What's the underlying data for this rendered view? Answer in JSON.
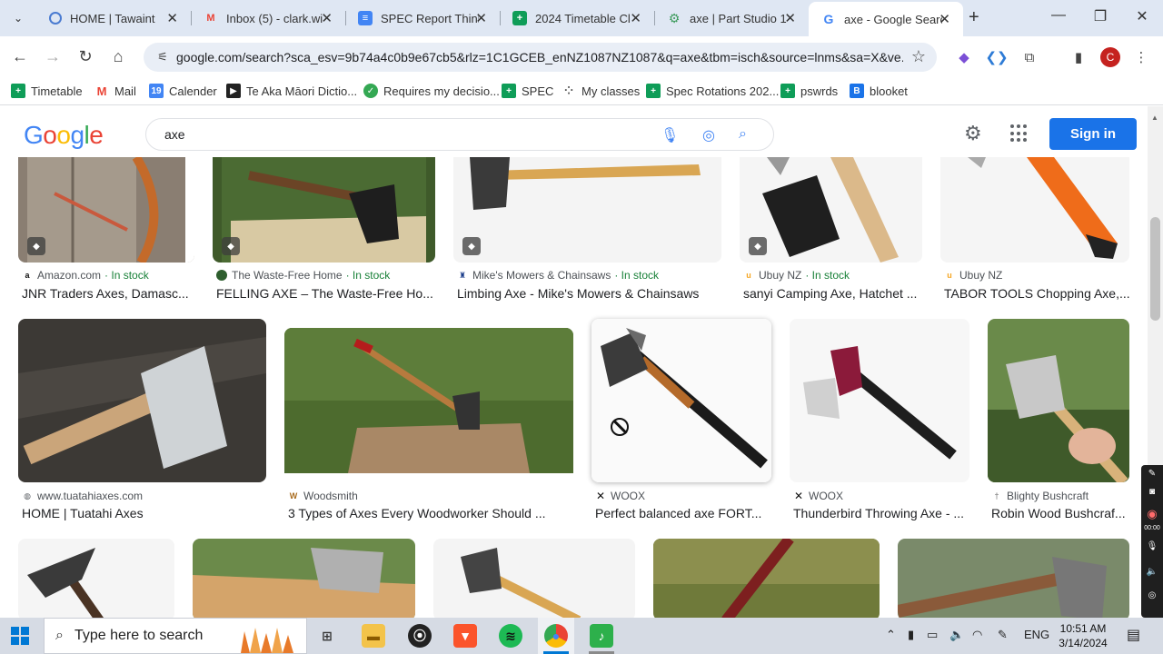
{
  "browser": {
    "tab_menu_icon": "chevron-down-icon",
    "tabs": [
      {
        "title": "HOME | Tawaint",
        "favicon": "tawaint-icon",
        "color": "#4a7bd1"
      },
      {
        "title": "Inbox (5) - clark.wi",
        "favicon": "gmail-icon",
        "color": "#ea4335"
      },
      {
        "title": "SPEC Report Think",
        "favicon": "docs-icon",
        "color": "#4285f4"
      },
      {
        "title": "2024 Timetable Cl",
        "favicon": "sheets-icon",
        "color": "#0f9d58"
      },
      {
        "title": "axe | Part Studio 1",
        "favicon": "onshape-icon",
        "color": "#3d9b5c"
      },
      {
        "title": "axe - Google Searc",
        "favicon": "google-icon",
        "color": "#4285f4"
      }
    ],
    "url": "google.com/search?sca_esv=9b74a4c0b9e67cb5&rlz=1C1GCEB_enNZ1087NZ1087&q=axe&tbm=isch&source=lnms&sa=X&ve...",
    "profile_initial": "C",
    "profile_color": "#c5221f"
  },
  "bookmarks": [
    {
      "label": "Timetable",
      "icon": "sheets-icon",
      "color": "#0f9d58"
    },
    {
      "label": "Mail",
      "icon": "gmail-icon",
      "color": "#ea4335"
    },
    {
      "label": "Calender",
      "icon": "calendar-icon",
      "color": "#4285f4"
    },
    {
      "label": "Te Aka Māori Dictio...",
      "icon": "teaka-icon",
      "color": "#222222"
    },
    {
      "label": "Requires my decisio...",
      "icon": "check-icon",
      "color": "#34a853"
    },
    {
      "label": "SPEC",
      "icon": "sheets-icon",
      "color": "#0f9d58"
    },
    {
      "label": "My classes",
      "icon": "classes-icon",
      "color": "#555555"
    },
    {
      "label": "Spec Rotations 202...",
      "icon": "sheets-icon",
      "color": "#0f9d58"
    },
    {
      "label": "pswrds",
      "icon": "sheets-icon",
      "color": "#0f9d58"
    },
    {
      "label": "blooket",
      "icon": "blooket-icon",
      "color": "#1a73e8"
    }
  ],
  "google": {
    "logo": "Google",
    "query": "axe",
    "signin_label": "Sign in"
  },
  "results": {
    "row1": [
      {
        "source": "Amazon.com",
        "stock": "· In stock",
        "title": "JNR Traders Axes, Damasc..."
      },
      {
        "source": "The Waste-Free Home",
        "stock": "· In stock",
        "title": "FELLING AXE – The Waste-Free Ho..."
      },
      {
        "source": "Mike's Mowers & Chainsaws",
        "stock": "· In stock",
        "title": "Limbing Axe - Mike's Mowers & Chainsaws"
      },
      {
        "source": "Ubuy NZ",
        "stock": "· In stock",
        "title": "sanyi Camping Axe, Hatchet ..."
      },
      {
        "source": "Ubuy NZ",
        "stock": "",
        "title": "TABOR TOOLS Chopping Axe,..."
      }
    ],
    "row2": [
      {
        "source": "www.tuatahiaxes.com",
        "stock": "",
        "title": "HOME | Tuatahi Axes"
      },
      {
        "source": "Woodsmith",
        "stock": "",
        "title": "3 Types of Axes Every Woodworker Should ..."
      },
      {
        "source": "WOOX",
        "stock": "",
        "title": "Perfect balanced axe FORT..."
      },
      {
        "source": "WOOX",
        "stock": "",
        "title": "Thunderbird Throwing Axe - ..."
      },
      {
        "source": "Blighty Bushcraft",
        "stock": "",
        "title": "Robin Wood Bushcraf..."
      }
    ]
  },
  "recorder": {
    "time": "00:00"
  },
  "taskbar": {
    "search_placeholder": "Type here to search",
    "language": "ENG",
    "time": "10:51 AM",
    "date": "3/14/2024"
  }
}
